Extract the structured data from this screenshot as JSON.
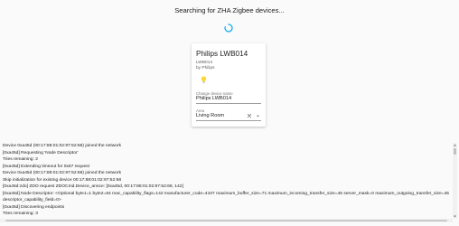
{
  "header": {
    "title": "Searching for ZHA Zigbee devices..."
  },
  "colors": {
    "accent": "#03a9f4",
    "bulb": "#fdd835",
    "background": "#fafafa",
    "card": "#ffffff"
  },
  "icons": {
    "spinner": "spinner-icon",
    "device": "lightbulb-icon",
    "clear": "close-icon",
    "dropdown": "chevron-down-icon"
  },
  "device_card": {
    "name": "Philips LWB014",
    "model": "LWB014",
    "manufacturer": "by Philips",
    "name_field": {
      "label": "Change device name",
      "value": "Philips LWB014"
    },
    "area_field": {
      "label": "Area",
      "value": "Living Room"
    }
  },
  "log": {
    "lines": [
      "Device 0xa45d (00:17:88:01:02:97:52:68) joined the network",
      "[0xa45d] Requesting 'Node Descriptor'",
      "Tries remaining: 2",
      "[0xa45d] Extending timeout for 0x67 request",
      "Device 0xa45d (00:17:88:01:02:97:52:68) joined the network",
      "Skip initialization for existing device 00:17:88:01:02:97:52:68",
      "[0xa45d:zdo] ZDO request ZDOCmd.Device_annce: [0xa45d, 00:17:88:01:02:97:52:68, 142]",
      "[0xa45d] Node Descriptor: <Optional byte1=1 byte2=64 mac_capability_flags=142 manufacturer_code=4107 maximum_buffer_size=71 maximum_incoming_transfer_size=45 server_mask=0 maximum_outgoing_transfer_size=45 descriptor_capability_field=0>",
      "[0xa45d] Discovering endpoints",
      "Tries remaining: 3"
    ]
  }
}
